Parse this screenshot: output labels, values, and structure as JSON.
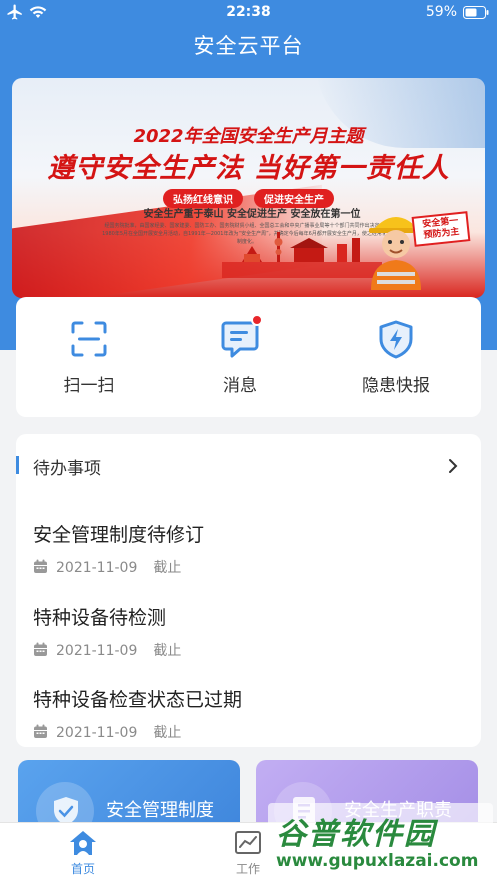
{
  "status_bar": {
    "time": "22:38",
    "battery": "59%"
  },
  "app": {
    "title": "安全云平台"
  },
  "banner": {
    "year_theme": "2022年全国安全生产月主题",
    "main_slogan": "遵守安全生产法  当好第一责任人",
    "pills": [
      "弘扬红线意识",
      "促进安全生产"
    ],
    "sub_slogan": "安全生产重于泰山 安全促进生产 安全放在第一位",
    "small_text": "经国务院批准，由国家经委、国家建委、国防工办、国务院财贸小组、全国总工会和中央广播事业局等十个部门共同作出决定，于1980年5月在全国开展安全月活动，自1991年—2001年改为“安全生产周”，并确定今后每年6月都开展安全生产月，使之经常化、制度化。",
    "badge": "安全第一预防为主"
  },
  "quick_actions": [
    {
      "label": "扫一扫",
      "icon": "scan-icon"
    },
    {
      "label": "消息",
      "icon": "message-icon",
      "has_dot": true
    },
    {
      "label": "隐患快报",
      "icon": "shield-bolt-icon"
    }
  ],
  "todo": {
    "title": "待办事项",
    "items": [
      {
        "title": "安全管理制度待修订",
        "date": "2021-11-09",
        "status": "截止"
      },
      {
        "title": "特种设备待检测",
        "date": "2021-11-09",
        "status": "截止"
      },
      {
        "title": "特种设备检查状态已过期",
        "date": "2021-11-09",
        "status": "截止"
      }
    ]
  },
  "tiles": [
    {
      "label": "安全管理制度",
      "icon": "shield-check-icon"
    },
    {
      "label": "安全生产职责",
      "icon": "document-icon"
    }
  ],
  "tabbar": {
    "tabs": [
      {
        "label": "首页",
        "icon": "home-icon",
        "active": true
      },
      {
        "label": "工作",
        "icon": "chart-icon",
        "active": false
      }
    ]
  },
  "watermark": {
    "brand": "谷普软件园",
    "url": "www.gupuxlazai.com"
  },
  "colors": {
    "primary": "#3e8be0",
    "alert": "#e8262b",
    "tile_blue": "#4a93e6",
    "tile_purple": "#b09cec"
  }
}
